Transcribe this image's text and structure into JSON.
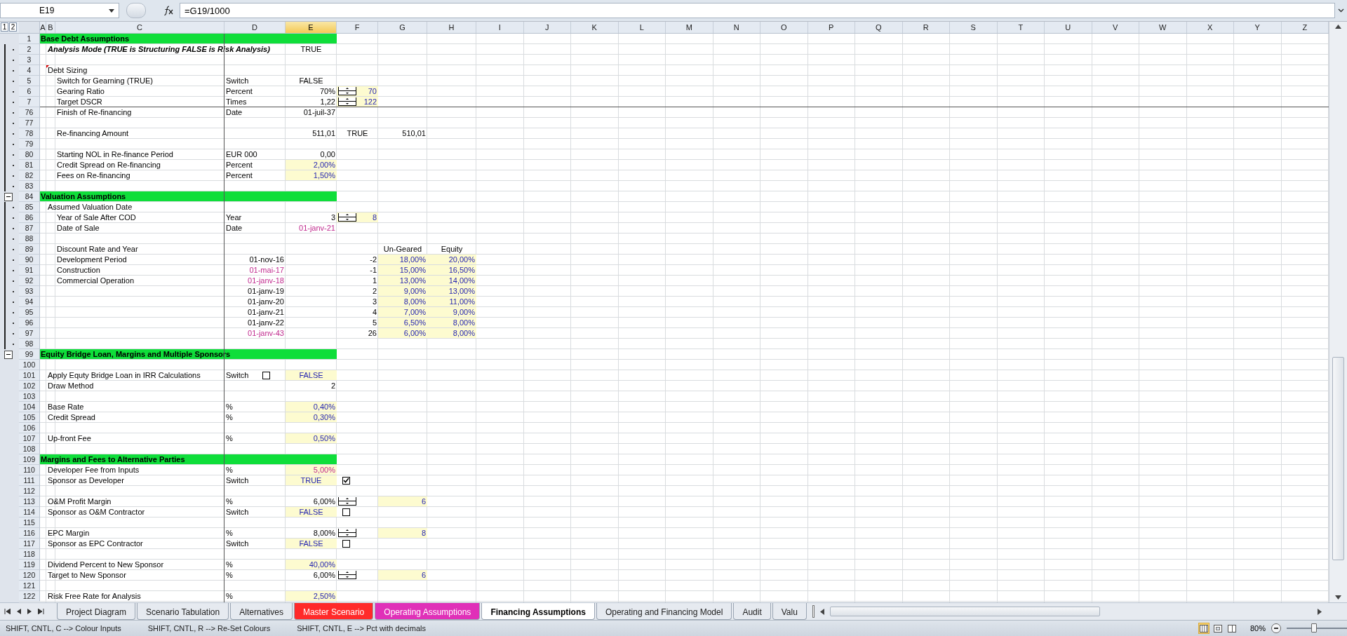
{
  "formula_bar": {
    "name_box": "E19",
    "formula": "=G19/1000"
  },
  "outline_levels": [
    "1",
    "2"
  ],
  "columns": [
    {
      "label": "A",
      "selected": false
    },
    {
      "label": "B",
      "selected": false
    },
    {
      "label": "C",
      "selected": false
    },
    {
      "label": "D",
      "selected": false
    },
    {
      "label": "E",
      "selected": true
    },
    {
      "label": "F",
      "selected": false
    },
    {
      "label": "G",
      "selected": false
    },
    {
      "label": "H",
      "selected": false
    },
    {
      "label": "I",
      "selected": false
    },
    {
      "label": "J",
      "selected": false
    },
    {
      "label": "K",
      "selected": false
    },
    {
      "label": "L",
      "selected": false
    },
    {
      "label": "M",
      "selected": false
    },
    {
      "label": "N",
      "selected": false
    },
    {
      "label": "O",
      "selected": false
    },
    {
      "label": "P",
      "selected": false
    },
    {
      "label": "Q",
      "selected": false
    },
    {
      "label": "R",
      "selected": false
    },
    {
      "label": "S",
      "selected": false
    },
    {
      "label": "T",
      "selected": false
    },
    {
      "label": "U",
      "selected": false
    },
    {
      "label": "V",
      "selected": false
    },
    {
      "label": "W",
      "selected": false
    },
    {
      "label": "X",
      "selected": false
    },
    {
      "label": "Y",
      "selected": false
    },
    {
      "label": "Z",
      "selected": false
    }
  ],
  "rows": [
    {
      "number": "1",
      "kind": "section",
      "cells": {
        "A": {
          "text": "Base Debt Assumptions",
          "kind": "label"
        }
      }
    },
    {
      "number": "2",
      "kind": "subheading",
      "grouped": true,
      "cells": {
        "B": {
          "text": "Analysis Mode (TRUE is Structuring FALSE is Risk Analysis)",
          "kind": "label"
        },
        "E": {
          "text": "TRUE",
          "kind": "flag"
        }
      }
    },
    {
      "number": "3",
      "kind": "data",
      "grouped": true,
      "cells": {}
    },
    {
      "number": "4",
      "kind": "subheading",
      "grouped": true,
      "cells": {
        "B": {
          "text": "Debt Sizing",
          "kind": "label",
          "comment": true
        }
      }
    },
    {
      "number": "5",
      "kind": "data",
      "grouped": true,
      "cells": {
        "C": {
          "text": "Switch for Gearning (TRUE)",
          "kind": "label"
        },
        "D": {
          "text": "Switch",
          "kind": "label"
        },
        "E": {
          "text": "FALSE",
          "kind": "flag"
        }
      }
    },
    {
      "number": "6",
      "kind": "data",
      "grouped": true,
      "cells": {
        "C": {
          "text": "Gearing Ratio",
          "kind": "label"
        },
        "D": {
          "text": "Percent",
          "kind": "label"
        },
        "E": {
          "text": "70%",
          "kind": "number"
        },
        "F": {
          "text": "70",
          "kind": "input_number",
          "fill": true,
          "control": {
            "kind": "spinner"
          }
        }
      }
    },
    {
      "number": "7",
      "kind": "data",
      "grouped": true,
      "pane_split": true,
      "cells": {
        "C": {
          "text": "Target DSCR",
          "kind": "label"
        },
        "D": {
          "text": "Times",
          "kind": "label"
        },
        "E": {
          "text": "1,22",
          "kind": "number"
        },
        "F": {
          "text": "122",
          "kind": "input_number",
          "fill": true,
          "control": {
            "kind": "spinner"
          }
        }
      }
    },
    {
      "number": "76",
      "kind": "data",
      "grouped": true,
      "cells": {
        "C": {
          "text": "Finish of Re-financing",
          "kind": "label"
        },
        "D": {
          "text": "Date",
          "kind": "label"
        },
        "E": {
          "text": "01-juil-37",
          "kind": "number"
        }
      }
    },
    {
      "number": "77",
      "kind": "data",
      "grouped": true,
      "cells": {}
    },
    {
      "number": "78",
      "kind": "data",
      "grouped": true,
      "cells": {
        "C": {
          "text": "Re-financing Amount",
          "kind": "label"
        },
        "E": {
          "text": "511,01",
          "kind": "number"
        },
        "F": {
          "text": "TRUE",
          "kind": "flag"
        },
        "G": {
          "text": "510,01",
          "kind": "number"
        }
      }
    },
    {
      "number": "79",
      "kind": "data",
      "grouped": true,
      "cells": {}
    },
    {
      "number": "80",
      "kind": "data",
      "grouped": true,
      "cells": {
        "C": {
          "text": "Starting NOL in Re-finance Period",
          "kind": "label"
        },
        "D": {
          "text": "EUR 000",
          "kind": "label"
        },
        "E": {
          "text": "0,00",
          "kind": "number"
        }
      }
    },
    {
      "number": "81",
      "kind": "data",
      "grouped": true,
      "cells": {
        "C": {
          "text": "Credit Spread on Re-financing",
          "kind": "label"
        },
        "D": {
          "text": "Percent",
          "kind": "label"
        },
        "E": {
          "text": "2,00%",
          "kind": "input_number",
          "fill": true
        }
      }
    },
    {
      "number": "82",
      "kind": "data",
      "grouped": true,
      "cells": {
        "C": {
          "text": "Fees on Re-financing",
          "kind": "label"
        },
        "D": {
          "text": "Percent",
          "kind": "label"
        },
        "E": {
          "text": "1,50%",
          "kind": "input_number",
          "fill": true
        }
      }
    },
    {
      "number": "83",
      "kind": "data",
      "grouped": true,
      "cells": {}
    },
    {
      "number": "84",
      "kind": "section",
      "collapse_button": true,
      "cells": {
        "A": {
          "text": "Valuation Assumptions",
          "kind": "label"
        }
      }
    },
    {
      "number": "85",
      "kind": "data",
      "grouped": true,
      "cells": {
        "B": {
          "text": "Assumed Valuation Date",
          "kind": "label"
        }
      }
    },
    {
      "number": "86",
      "kind": "data",
      "grouped": true,
      "cells": {
        "C": {
          "text": "Year of Sale After COD",
          "kind": "label"
        },
        "D": {
          "text": "Year",
          "kind": "label"
        },
        "E": {
          "text": "3",
          "kind": "number"
        },
        "F": {
          "text": "8",
          "kind": "input_number",
          "fill": true,
          "control": {
            "kind": "spinner"
          }
        }
      }
    },
    {
      "number": "87",
      "kind": "data",
      "grouped": true,
      "cells": {
        "C": {
          "text": "Date of Sale",
          "kind": "label"
        },
        "D": {
          "text": "Date",
          "kind": "label"
        },
        "E": {
          "text": "01-janv-21",
          "kind": "link_number"
        }
      }
    },
    {
      "number": "88",
      "kind": "data",
      "grouped": true,
      "cells": {}
    },
    {
      "number": "89",
      "kind": "data",
      "grouped": true,
      "cells": {
        "C": {
          "text": "Discount Rate and Year",
          "kind": "label"
        },
        "G": {
          "text": "Un-Geared",
          "kind": "flag"
        },
        "H": {
          "text": "Equity",
          "kind": "flag"
        }
      }
    },
    {
      "number": "90",
      "kind": "data",
      "grouped": true,
      "cells": {
        "C": {
          "text": "Development Period",
          "kind": "label"
        },
        "D": {
          "text": "01-nov-16",
          "kind": "number"
        },
        "F": {
          "text": "-2",
          "kind": "number"
        },
        "G": {
          "text": "18,00%",
          "kind": "input_number",
          "fill": true
        },
        "H": {
          "text": "20,00%",
          "kind": "input_number",
          "fill": true
        }
      }
    },
    {
      "number": "91",
      "kind": "data",
      "grouped": true,
      "cells": {
        "C": {
          "text": "Construction",
          "kind": "label"
        },
        "D": {
          "text": "01-mai-17",
          "kind": "link_number"
        },
        "F": {
          "text": "-1",
          "kind": "number"
        },
        "G": {
          "text": "15,00%",
          "kind": "input_number",
          "fill": true
        },
        "H": {
          "text": "16,50%",
          "kind": "input_number",
          "fill": true
        }
      }
    },
    {
      "number": "92",
      "kind": "data",
      "grouped": true,
      "cells": {
        "C": {
          "text": "Commercial Operation",
          "kind": "label"
        },
        "D": {
          "text": "01-janv-18",
          "kind": "link_number"
        },
        "F": {
          "text": "1",
          "kind": "number"
        },
        "G": {
          "text": "13,00%",
          "kind": "input_number",
          "fill": true
        },
        "H": {
          "text": "14,00%",
          "kind": "input_number",
          "fill": true
        }
      }
    },
    {
      "number": "93",
      "kind": "data",
      "grouped": true,
      "cells": {
        "D": {
          "text": "01-janv-19",
          "kind": "number"
        },
        "F": {
          "text": "2",
          "kind": "number"
        },
        "G": {
          "text": "9,00%",
          "kind": "input_number",
          "fill": true
        },
        "H": {
          "text": "13,00%",
          "kind": "input_number",
          "fill": true
        }
      }
    },
    {
      "number": "94",
      "kind": "data",
      "grouped": true,
      "cells": {
        "D": {
          "text": "01-janv-20",
          "kind": "number"
        },
        "F": {
          "text": "3",
          "kind": "number"
        },
        "G": {
          "text": "8,00%",
          "kind": "input_number",
          "fill": true
        },
        "H": {
          "text": "11,00%",
          "kind": "input_number",
          "fill": true
        }
      }
    },
    {
      "number": "95",
      "kind": "data",
      "grouped": true,
      "cells": {
        "D": {
          "text": "01-janv-21",
          "kind": "number"
        },
        "F": {
          "text": "4",
          "kind": "number"
        },
        "G": {
          "text": "7,00%",
          "kind": "input_number",
          "fill": true
        },
        "H": {
          "text": "9,00%",
          "kind": "input_number",
          "fill": true
        }
      }
    },
    {
      "number": "96",
      "kind": "data",
      "grouped": true,
      "cells": {
        "D": {
          "text": "01-janv-22",
          "kind": "number"
        },
        "F": {
          "text": "5",
          "kind": "number"
        },
        "G": {
          "text": "6,50%",
          "kind": "input_number",
          "fill": true
        },
        "H": {
          "text": "8,00%",
          "kind": "input_number",
          "fill": true
        }
      }
    },
    {
      "number": "97",
      "kind": "data",
      "grouped": true,
      "cells": {
        "D": {
          "text": "01-janv-43",
          "kind": "link_number"
        },
        "F": {
          "text": "26",
          "kind": "number"
        },
        "G": {
          "text": "6,00%",
          "kind": "input_number",
          "fill": true
        },
        "H": {
          "text": "8,00%",
          "kind": "input_number",
          "fill": true
        }
      }
    },
    {
      "number": "98",
      "kind": "data",
      "grouped": true,
      "cells": {}
    },
    {
      "number": "99",
      "kind": "section",
      "collapse_button": true,
      "cells": {
        "A": {
          "text": "Equity Bridge Loan, Margins and Multiple Sponsors",
          "kind": "label"
        }
      }
    },
    {
      "number": "100",
      "kind": "data",
      "cells": {}
    },
    {
      "number": "101",
      "kind": "data",
      "cells": {
        "B": {
          "text": "Apply Equty Bridge Loan in IRR Calculations",
          "kind": "label"
        },
        "D": {
          "text": "Switch",
          "kind": "label",
          "control": {
            "kind": "checkbox",
            "checked": false
          }
        },
        "E": {
          "text": "FALSE",
          "kind": "input_flag",
          "fill": true
        }
      }
    },
    {
      "number": "102",
      "kind": "data",
      "cells": {
        "B": {
          "text": "Draw Method",
          "kind": "label"
        },
        "E": {
          "text": "2",
          "kind": "number"
        }
      }
    },
    {
      "number": "103",
      "kind": "data",
      "cells": {}
    },
    {
      "number": "104",
      "kind": "data",
      "cells": {
        "B": {
          "text": "Base Rate",
          "kind": "label"
        },
        "D": {
          "text": "%",
          "kind": "label"
        },
        "E": {
          "text": "0,40%",
          "kind": "input_number",
          "fill": true
        }
      }
    },
    {
      "number": "105",
      "kind": "data",
      "cells": {
        "B": {
          "text": "Credit Spread",
          "kind": "label"
        },
        "D": {
          "text": "%",
          "kind": "label"
        },
        "E": {
          "text": "0,30%",
          "kind": "input_number",
          "fill": true
        }
      }
    },
    {
      "number": "106",
      "kind": "data",
      "cells": {}
    },
    {
      "number": "107",
      "kind": "data",
      "cells": {
        "B": {
          "text": "Up-front Fee",
          "kind": "label"
        },
        "D": {
          "text": "%",
          "kind": "label"
        },
        "E": {
          "text": "0,50%",
          "kind": "input_number",
          "fill": true
        }
      }
    },
    {
      "number": "108",
      "kind": "data",
      "cells": {}
    },
    {
      "number": "109",
      "kind": "section",
      "cells": {
        "A": {
          "text": "Margins and Fees to Alternative Parties",
          "kind": "label"
        }
      }
    },
    {
      "number": "110",
      "kind": "data",
      "cells": {
        "B": {
          "text": "Developer Fee from Inputs",
          "kind": "label"
        },
        "D": {
          "text": "%",
          "kind": "label"
        },
        "E": {
          "text": "5,00%",
          "kind": "link_number",
          "fill": true
        }
      }
    },
    {
      "number": "111",
      "kind": "data",
      "cells": {
        "B": {
          "text": "Sponsor as Developer",
          "kind": "label"
        },
        "D": {
          "text": "Switch",
          "kind": "label"
        },
        "E": {
          "text": "TRUE",
          "kind": "input_flag",
          "fill": true
        },
        "F": {
          "control": {
            "kind": "checkbox",
            "checked": true
          }
        }
      }
    },
    {
      "number": "112",
      "kind": "data",
      "cells": {}
    },
    {
      "number": "113",
      "kind": "data",
      "cells": {
        "B": {
          "text": "O&M Profit Margin",
          "kind": "label"
        },
        "D": {
          "text": "%",
          "kind": "label"
        },
        "E": {
          "text": "6,00%",
          "kind": "number"
        },
        "F": {
          "control": {
            "kind": "spinner"
          }
        },
        "G": {
          "text": "6",
          "kind": "input_number",
          "fill": true
        }
      }
    },
    {
      "number": "114",
      "kind": "data",
      "cells": {
        "B": {
          "text": "Sponsor as O&M Contractor",
          "kind": "label"
        },
        "D": {
          "text": "Switch",
          "kind": "label"
        },
        "E": {
          "text": "FALSE",
          "kind": "input_flag",
          "fill": true
        },
        "F": {
          "control": {
            "kind": "checkbox",
            "checked": false
          }
        }
      }
    },
    {
      "number": "115",
      "kind": "data",
      "cells": {}
    },
    {
      "number": "116",
      "kind": "data",
      "cells": {
        "B": {
          "text": "EPC Margin",
          "kind": "label"
        },
        "D": {
          "text": "%",
          "kind": "label"
        },
        "E": {
          "text": "8,00%",
          "kind": "number"
        },
        "F": {
          "control": {
            "kind": "spinner"
          }
        },
        "G": {
          "text": "8",
          "kind": "input_number",
          "fill": true
        }
      }
    },
    {
      "number": "117",
      "kind": "data",
      "cells": {
        "B": {
          "text": "Sponsor as EPC Contractor",
          "kind": "label"
        },
        "D": {
          "text": "Switch",
          "kind": "label"
        },
        "E": {
          "text": "FALSE",
          "kind": "input_flag",
          "fill": true
        },
        "F": {
          "control": {
            "kind": "checkbox",
            "checked": false
          }
        }
      }
    },
    {
      "number": "118",
      "kind": "data",
      "cells": {}
    },
    {
      "number": "119",
      "kind": "data",
      "cells": {
        "B": {
          "text": "Dividend Percent to New Sponsor",
          "kind": "label"
        },
        "D": {
          "text": "%",
          "kind": "label"
        },
        "E": {
          "text": "40,00%",
          "kind": "input_number",
          "fill": true
        }
      }
    },
    {
      "number": "120",
      "kind": "data",
      "cells": {
        "B": {
          "text": "Target to New Sponsor",
          "kind": "label"
        },
        "D": {
          "text": "%",
          "kind": "label"
        },
        "E": {
          "text": "6,00%",
          "kind": "number"
        },
        "F": {
          "control": {
            "kind": "spinner"
          }
        },
        "G": {
          "text": "6",
          "kind": "input_number",
          "fill": true
        }
      }
    },
    {
      "number": "121",
      "kind": "data",
      "cells": {}
    },
    {
      "number": "122",
      "kind": "data",
      "cells": {
        "B": {
          "text": "Risk Free Rate for Analysis",
          "kind": "label"
        },
        "D": {
          "text": "%",
          "kind": "label"
        },
        "E": {
          "text": "2,50%",
          "kind": "input_number",
          "fill": true
        }
      }
    }
  ],
  "sheet_tabs": [
    {
      "label": "Project Diagram",
      "selected": false
    },
    {
      "label": "Scenario Tabulation",
      "selected": false
    },
    {
      "label": "Alternatives",
      "selected": false
    },
    {
      "label": "Master Scenario",
      "selected": false,
      "color": "#ff2a2a"
    },
    {
      "label": "Operating Assumptions",
      "selected": false,
      "color": "#e030b8"
    },
    {
      "label": "Financing Assumptions",
      "selected": true
    },
    {
      "label": "Operating and Financing Model",
      "selected": false
    },
    {
      "label": "Audit",
      "selected": false
    },
    {
      "label": "Valu",
      "selected": false
    }
  ],
  "status_bar": {
    "messages": [
      "SHIFT, CNTL, C --> Colour Inputs",
      "SHIFT, CNTL, R --> Re-Set Colours",
      "SHIFT, CNTL, E --> Pct with decimals"
    ],
    "zoom": "80%",
    "zoom_slider": {
      "level": 0.45
    }
  }
}
